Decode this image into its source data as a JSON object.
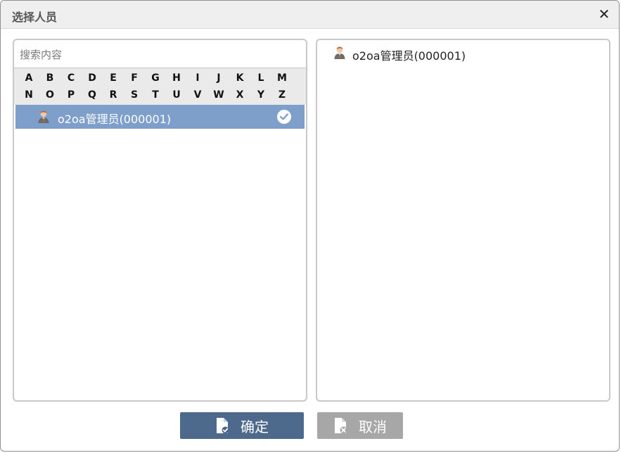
{
  "dialog": {
    "title": "选择人员",
    "close_symbol": "✕"
  },
  "search": {
    "placeholder": "搜索内容",
    "value": ""
  },
  "alphabet": {
    "row1": [
      "A",
      "B",
      "C",
      "D",
      "E",
      "F",
      "G",
      "H",
      "I",
      "J",
      "K",
      "L",
      "M"
    ],
    "row2": [
      "N",
      "O",
      "P",
      "Q",
      "R",
      "S",
      "T",
      "U",
      "V",
      "W",
      "X",
      "Y",
      "Z"
    ]
  },
  "list": {
    "items": [
      {
        "name": "o2oa管理员(000001)",
        "selected": true,
        "icon": "person-icon"
      }
    ]
  },
  "selected": {
    "items": [
      {
        "name": "o2oa管理员(000001)",
        "icon": "person-icon"
      }
    ]
  },
  "buttons": {
    "ok_label": "确定",
    "cancel_label": "取消"
  },
  "colors": {
    "selected_row": "#7f9fcb",
    "ok_button": "#4d6a8c",
    "cancel_button": "#a7a7a7"
  }
}
